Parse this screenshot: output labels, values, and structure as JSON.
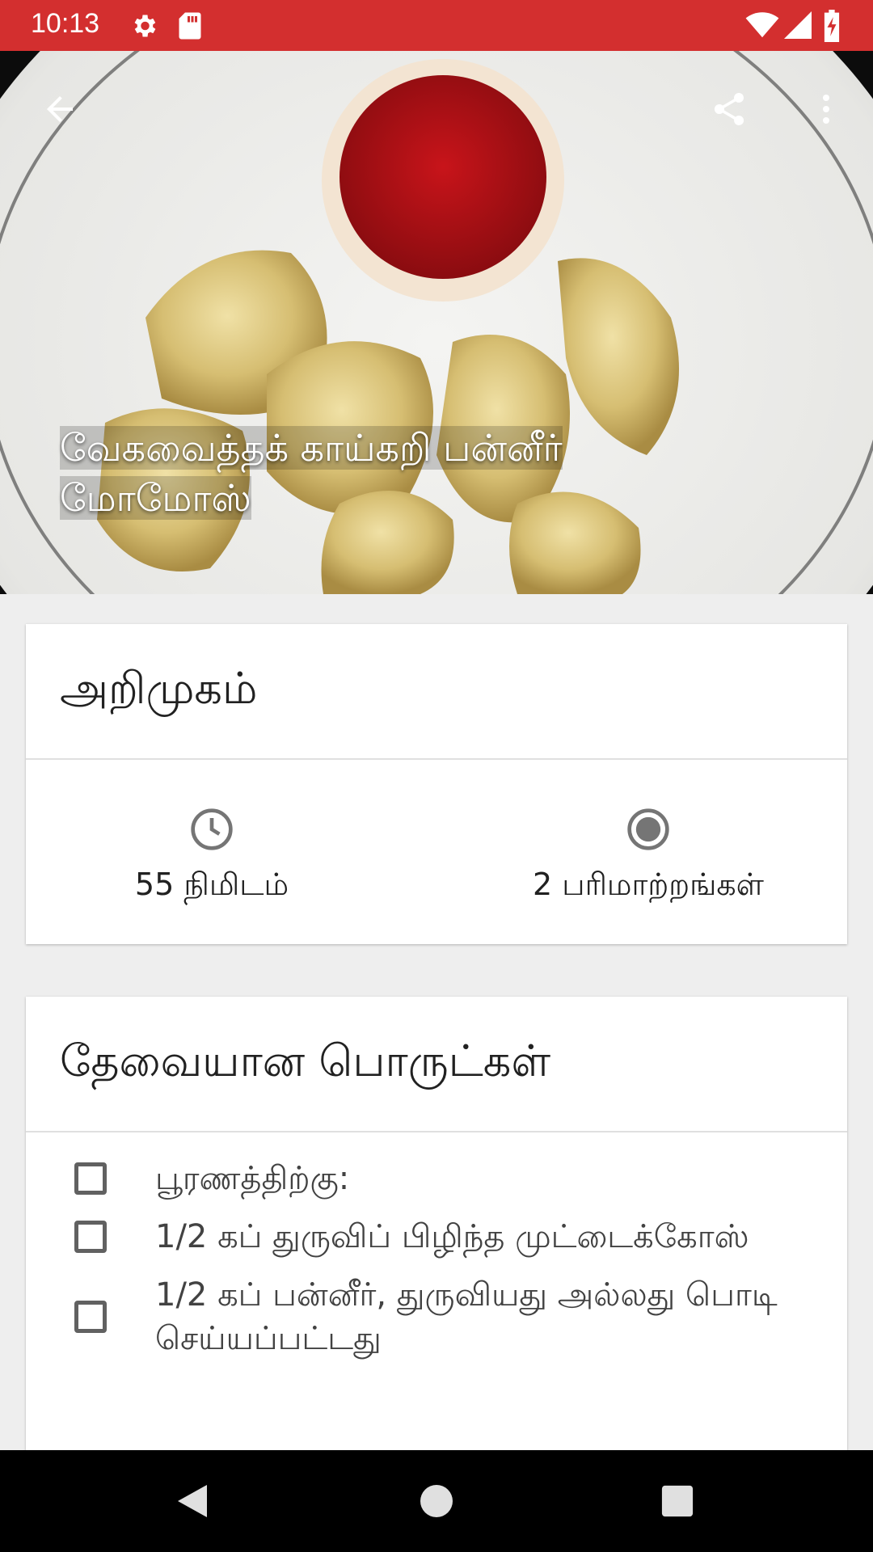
{
  "status_bar": {
    "time": "10:13",
    "icons_left": [
      "settings-icon",
      "sd-card-icon"
    ],
    "icons_right": [
      "wifi-icon",
      "signal-icon",
      "battery-icon"
    ],
    "color": "#d32f2f"
  },
  "toolbar": {
    "back_icon": "arrow-back-icon",
    "share_icon": "share-icon",
    "more_icon": "more-vert-icon"
  },
  "hero": {
    "title": "வேகவைத்தக் காய்கறி பன்னீர் மோமோஸ்"
  },
  "intro_card": {
    "title": "அறிமுகம்",
    "time_icon": "clock-icon",
    "time_label": "55 நிமிடம்",
    "servings_icon": "radio-button-icon",
    "servings_label": "2 பரிமாற்றங்கள்"
  },
  "ingredients_card": {
    "title": "தேவையான பொருட்கள்",
    "items": [
      {
        "text": "பூரணத்திற்கு:",
        "checked": false
      },
      {
        "text": "1/2 கப் துருவிப் பிழிந்த முட்டைக்கோஸ்",
        "checked": false
      },
      {
        "text": "1/2 கப் பன்னீர், துருவியது அல்லது பொடி செய்யப்பட்டது",
        "checked": false
      }
    ]
  },
  "nav_bar": {
    "back_icon": "nav-back-icon",
    "home_icon": "nav-home-icon",
    "recents_icon": "nav-recents-icon"
  }
}
